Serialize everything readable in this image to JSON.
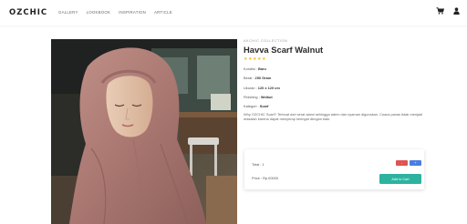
{
  "header": {
    "logo": "OZCHIC",
    "nav": [
      "GALLERY",
      "LOOKBOOK",
      "INSPIRATION",
      "ARTICLE"
    ],
    "icons": [
      "cart-icon",
      "user-icon"
    ]
  },
  "product": {
    "collection": "AKCHIC COLLECTION",
    "name": "Havva Scarf Walnut",
    "rating_stars": 5,
    "specs": {
      "kondisi_label": "Kondisi : ",
      "kondisi_value": "Baru",
      "berat_label": "Berat : ",
      "berat_value": "250 Gram",
      "ukuran_label": "Ukuran : ",
      "ukuran_value": "120 x 120 cm",
      "finishing_label": "Finishing : ",
      "finishing_value": "Wolkut",
      "kategori_label": "Kategori : ",
      "kategori_value": "Scarf"
    },
    "description": "Why OZCHIC Scarf? Terbuat dari serat alami sehingga adem dan nyaman digunakan. Cuaca panas tidak menjadi masalah karena dapat menyerap keringat dengan baik."
  },
  "purchase": {
    "total_label": "Total : 1",
    "price_label": "Price : Rp.00000",
    "minus_label": "-",
    "plus_label": "+",
    "cart_label": "Add to Cart"
  },
  "colors": {
    "accent": "#2bb3a0",
    "minus": "#e05252",
    "plus": "#4a7de0",
    "star": "#f0c020",
    "hijab": "#b07f7a"
  }
}
